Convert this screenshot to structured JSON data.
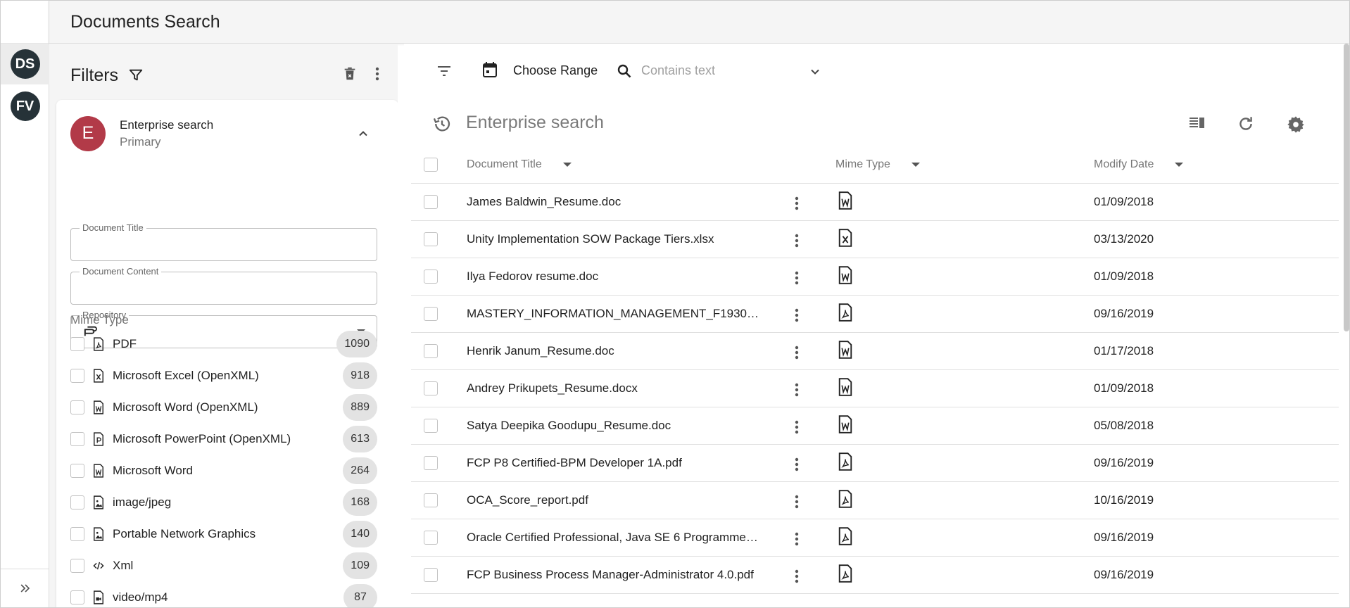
{
  "header": {
    "title": "Documents Search"
  },
  "rail": {
    "items": [
      "DS",
      "FV"
    ]
  },
  "filters": {
    "title": "Filters",
    "card": {
      "avatar_letter": "E",
      "title": "Enterprise search",
      "subtitle": "Primary"
    },
    "fields": {
      "document_title_label": "Document Title",
      "document_title_value": "",
      "document_content_label": "Document Content",
      "document_content_value": "",
      "repository_label": "Repository"
    },
    "mime_heading": "Mime Type",
    "mime_types": [
      {
        "label": "PDF",
        "count": "1090",
        "icon": "pdf-icon"
      },
      {
        "label": "Microsoft Excel (OpenXML)",
        "count": "918",
        "icon": "excel-icon"
      },
      {
        "label": "Microsoft Word (OpenXML)",
        "count": "889",
        "icon": "word-icon"
      },
      {
        "label": "Microsoft PowerPoint (OpenXML)",
        "count": "613",
        "icon": "powerpoint-icon"
      },
      {
        "label": "Microsoft Word",
        "count": "264",
        "icon": "word-icon"
      },
      {
        "label": "image/jpeg",
        "count": "168",
        "icon": "image-icon"
      },
      {
        "label": "Portable Network Graphics",
        "count": "140",
        "icon": "image-icon"
      },
      {
        "label": "Xml",
        "count": "109",
        "icon": "code-icon"
      },
      {
        "label": "video/mp4",
        "count": "87",
        "icon": "video-icon"
      }
    ]
  },
  "toolbar": {
    "range_label": "Choose Range",
    "search_placeholder": "Contains text"
  },
  "results": {
    "title": "Enterprise search",
    "columns": [
      "Document Title",
      "Mime Type",
      "Modify Date"
    ],
    "rows": [
      {
        "title": "James Baldwin_Resume.doc",
        "mime": "word",
        "date": "01/09/2018"
      },
      {
        "title": "Unity Implementation SOW Package Tiers.xlsx",
        "mime": "excel",
        "date": "03/13/2020"
      },
      {
        "title": "Ilya Fedorov resume.doc",
        "mime": "word",
        "date": "01/09/2018"
      },
      {
        "title": "MASTERY_INFORMATION_MANAGEMENT_F1930…",
        "mime": "pdf",
        "date": "09/16/2019"
      },
      {
        "title": "Henrik Janum_Resume.doc",
        "mime": "word",
        "date": "01/17/2018"
      },
      {
        "title": "Andrey Prikupets_Resume.docx",
        "mime": "word",
        "date": "01/09/2018"
      },
      {
        "title": "Satya Deepika Goodupu_Resume.doc",
        "mime": "word",
        "date": "05/08/2018"
      },
      {
        "title": "FCP P8 Certified-BPM Developer 1A.pdf",
        "mime": "pdf",
        "date": "09/16/2019"
      },
      {
        "title": "OCA_Score_report.pdf",
        "mime": "pdf",
        "date": "10/16/2019"
      },
      {
        "title": "Oracle Certified Professional, Java SE 6 Programme…",
        "mime": "pdf",
        "date": "09/16/2019"
      },
      {
        "title": "FCP Business Process Manager-Administrator 4.0.pdf",
        "mime": "pdf",
        "date": "09/16/2019"
      }
    ]
  }
}
